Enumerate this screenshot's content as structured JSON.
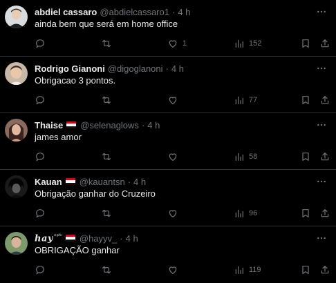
{
  "colors": {
    "background": "#000000",
    "text_primary": "#e7e9ea",
    "text_secondary": "#71767b",
    "divider": "#2f3336"
  },
  "tweets": [
    {
      "name": "abdiel cassaro",
      "handle": "@abdielcassaro1",
      "separator": "·",
      "time": "4 h",
      "text": "ainda bem que será em home office",
      "likes": "1",
      "views": "152",
      "replies": "",
      "retweets": "",
      "flag": false,
      "avatar_color": "#cfd3d6"
    },
    {
      "name": "Rodrigo Gianoni",
      "handle": "@digoglanoni",
      "separator": "·",
      "time": "4 h",
      "text": "Obrigacao 3 pontos.",
      "likes": "",
      "views": "77",
      "replies": "",
      "retweets": "",
      "flag": false,
      "avatar_color": "#b89a86"
    },
    {
      "name": "Thaise",
      "handle": "@selenaglows",
      "separator": "·",
      "time": "4 h",
      "text": "james amor",
      "likes": "",
      "views": "58",
      "replies": "",
      "retweets": "",
      "flag": true,
      "avatar_color": "#9c7060"
    },
    {
      "name": "Kauan",
      "handle": "@kauantsn",
      "separator": "·",
      "time": "4 h",
      "text": "Obrigação ganhar do Cruzeiro",
      "likes": "",
      "views": "96",
      "replies": "",
      "retweets": "",
      "flag": true,
      "avatar_color": "#2a2a2a"
    },
    {
      "name": "hay",
      "name_sup": "ᵒᵖᵏ",
      "handle": "@hayyv_",
      "separator": "·",
      "time": "4 h",
      "text": "OBRIGAÇÃO ganhar",
      "likes": "",
      "views": "119",
      "replies": "",
      "retweets": "",
      "flag": true,
      "avatar_color": "#6b8a5a"
    }
  ],
  "icons": {
    "more": "more-horizontal-icon",
    "reply": "reply-icon",
    "retweet": "retweet-icon",
    "like": "heart-icon",
    "views": "views-chart-icon",
    "bookmark": "bookmark-icon",
    "share": "share-icon"
  },
  "flag_colors": [
    "#e0001b",
    "#ffffff",
    "#111111"
  ]
}
